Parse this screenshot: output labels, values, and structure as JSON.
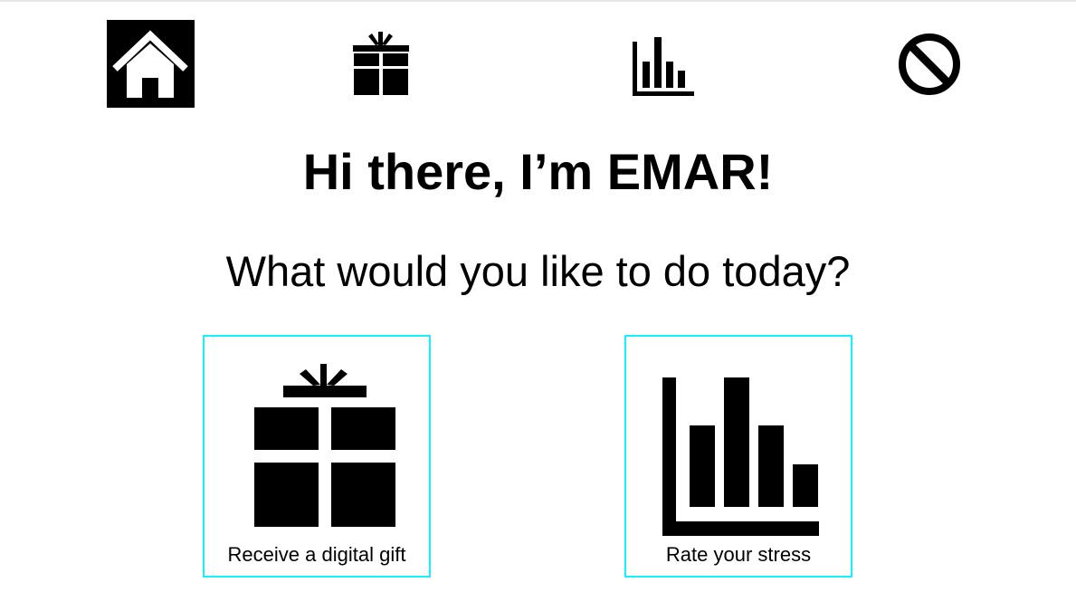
{
  "nav": {
    "items": [
      {
        "icon": "home-icon",
        "active": true
      },
      {
        "icon": "gift-icon",
        "active": false
      },
      {
        "icon": "bar-chart-icon",
        "active": false
      },
      {
        "icon": "block-icon",
        "active": false
      }
    ]
  },
  "main": {
    "greeting": "Hi there, I’m EMAR!",
    "prompt": "What would you like to do today?"
  },
  "options": [
    {
      "icon": "gift-icon",
      "label": "Receive a digital gift"
    },
    {
      "icon": "bar-chart-icon",
      "label": "Rate your stress"
    }
  ],
  "colors": {
    "card_border": "#19f0f4",
    "active_nav_bg": "#000000",
    "icon": "#000000"
  }
}
